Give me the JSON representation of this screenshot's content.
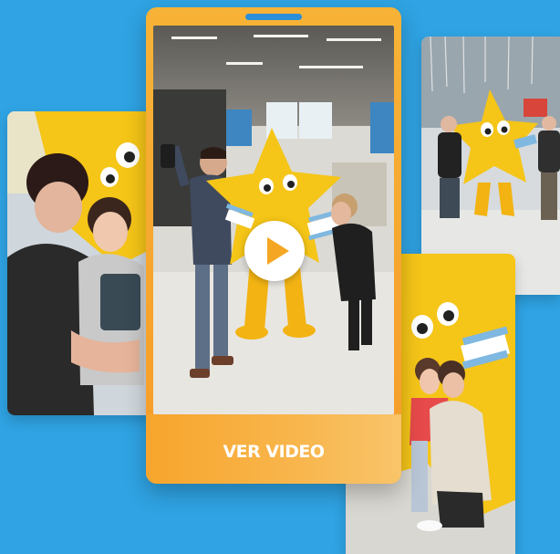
{
  "cta": {
    "label": "VER VIDEO"
  },
  "icons": {
    "play": "play-icon"
  },
  "colors": {
    "background": "#2fa3e3",
    "phone_frame": "#f6a52e",
    "mascot": "#f5c518",
    "play_triangle": "#f5a623"
  }
}
